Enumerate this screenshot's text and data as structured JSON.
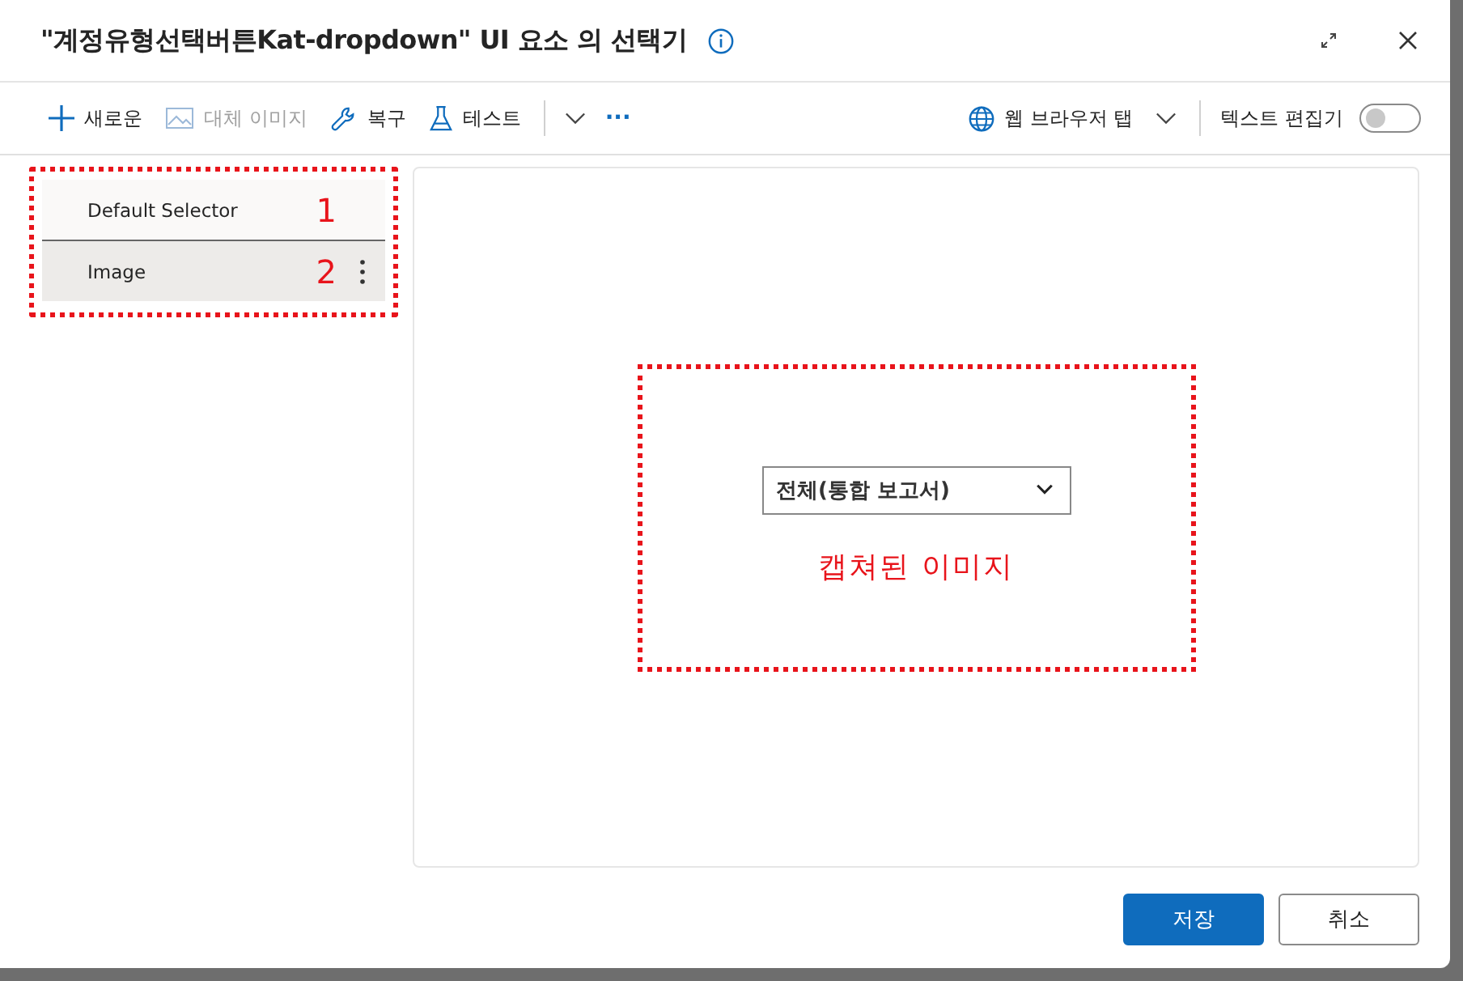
{
  "window": {
    "title": "\"계정유형선택버튼Kat-dropdown\" UI 요소 의 선택기"
  },
  "toolbar": {
    "items": [
      {
        "kind": "plus",
        "label": "새로운",
        "disabled": false
      },
      {
        "kind": "image",
        "label": "대체 이미지",
        "disabled": true
      },
      {
        "kind": "wrench",
        "label": "복구",
        "disabled": false
      },
      {
        "kind": "flask",
        "label": "테스트",
        "disabled": false,
        "dropdown": true
      },
      {
        "kind": "more",
        "label": "···",
        "disabled": false
      }
    ],
    "browser": {
      "label": "웹 브라우저 탭"
    },
    "text_editor": {
      "label": "텍스트 편집기",
      "on": false
    }
  },
  "selectors": [
    {
      "label": "Default Selector",
      "note": "1",
      "selected": false
    },
    {
      "label": "Image",
      "note": "2",
      "selected": true
    }
  ],
  "preview": {
    "captured_dropdown": {
      "value": "전체(통합 보고서)"
    },
    "caption": "캡쳐된 이미지"
  },
  "buttons": [
    {
      "label": "저장",
      "kind": "primary"
    },
    {
      "label": "취소",
      "kind": "secondary"
    }
  ]
}
